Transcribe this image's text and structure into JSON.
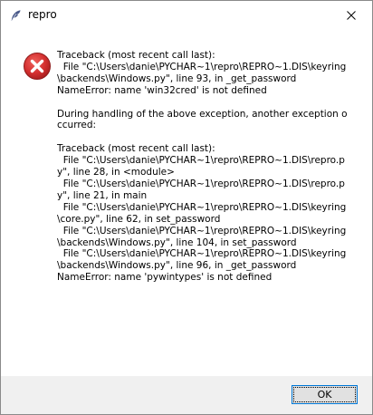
{
  "window": {
    "title": "repro",
    "title_icon": "feather-icon",
    "close_icon": "close-icon"
  },
  "dialog": {
    "icon": "error-icon",
    "message": "Traceback (most recent call last):\n  File \"C:\\Users\\danie\\PYCHAR~1\\repro\\REPRO~1.DIS\\keyring\\backends\\Windows.py\", line 93, in _get_password\nNameError: name 'win32cred' is not defined\n\nDuring handling of the above exception, another exception occurred:\n\nTraceback (most recent call last):\n  File \"C:\\Users\\danie\\PYCHAR~1\\repro\\REPRO~1.DIS\\repro.py\", line 28, in <module>\n  File \"C:\\Users\\danie\\PYCHAR~1\\repro\\REPRO~1.DIS\\repro.py\", line 21, in main\n  File \"C:\\Users\\danie\\PYCHAR~1\\repro\\REPRO~1.DIS\\keyring\\core.py\", line 62, in set_password\n  File \"C:\\Users\\danie\\PYCHAR~1\\repro\\REPRO~1.DIS\\keyring\\backends\\Windows.py\", line 104, in set_password\n  File \"C:\\Users\\danie\\PYCHAR~1\\repro\\REPRO~1.DIS\\keyring\\backends\\Windows.py\", line 96, in _get_password\nNameError: name 'pywintypes' is not defined",
    "ok_label": "OK"
  },
  "colors": {
    "error_red": "#d32f2f",
    "focus_blue": "#0078d7",
    "footer_bg": "#f0f0f0",
    "button_bg": "#e1e1e1"
  }
}
